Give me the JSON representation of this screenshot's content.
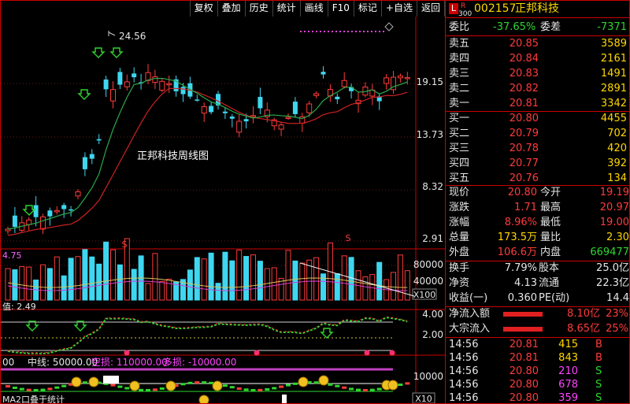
{
  "toolbar": {
    "items": [
      "复权",
      "叠加",
      "历史",
      "统计",
      "画线",
      "F10",
      "标记",
      "+自选",
      "返回"
    ]
  },
  "chart": {
    "title": "正邦科技周线图",
    "high_label": "24.56",
    "price_ticks": [
      "19.15",
      "13.73",
      "8.32",
      "2.91"
    ],
    "vol_left_label": "4.75",
    "vol_ticks": [
      "80000",
      "40000"
    ],
    "vol_unit": "X100",
    "ind_left_label": "值: 2.49",
    "ind_ticks": [
      "4.00",
      "2.00"
    ],
    "bottom_prefix": "00",
    "bottom_mid_label": "中线: 50000.00",
    "bottom_empty_label": "空损: 110000.00",
    "bottom_long_label": "多损: -10000.00",
    "bottom_tick": "10000",
    "bottom_unit": "X10",
    "bottom_caption": "MA2口叠于统计",
    "marker_s": "S",
    "colors": {
      "up": "#ff3b3b",
      "down": "#3fd7f0",
      "ma1": "#d8c060",
      "ma2": "#cc2222",
      "ma3": "#2aa84a"
    }
  },
  "quote": {
    "logo_l": "L",
    "logo_r": "R",
    "logo_code": "300",
    "code": "002157",
    "name": "正邦科技",
    "weibi_label": "委比",
    "weibi": "-37.65%",
    "weicha_label": "委差",
    "weicha": "-7371",
    "sells": [
      {
        "label": "卖五",
        "price": "20.85",
        "vol": "3589"
      },
      {
        "label": "卖四",
        "price": "20.84",
        "vol": "2161"
      },
      {
        "label": "卖三",
        "price": "20.83",
        "vol": "1491"
      },
      {
        "label": "卖二",
        "price": "20.82",
        "vol": "2891"
      },
      {
        "label": "卖一",
        "price": "20.81",
        "vol": "3342"
      }
    ],
    "buys": [
      {
        "label": "买一",
        "price": "20.80",
        "vol": "4455"
      },
      {
        "label": "买二",
        "price": "20.79",
        "vol": "702"
      },
      {
        "label": "买三",
        "price": "20.78",
        "vol": "420"
      },
      {
        "label": "买四",
        "price": "20.77",
        "vol": "392"
      },
      {
        "label": "买五",
        "price": "20.76",
        "vol": "134"
      }
    ],
    "stats": [
      {
        "l1": "现价",
        "v1": "20.80",
        "l2": "今开",
        "v2": "19.19"
      },
      {
        "l1": "涨跌",
        "v1": "1.71",
        "l2": "最高",
        "v2": "20.97"
      },
      {
        "l1": "涨幅",
        "v1": "8.96%",
        "l2": "最低",
        "v2": "19.00"
      },
      {
        "l1": "总量",
        "v1": "173.5万",
        "l2": "量比",
        "v2": "2.30"
      },
      {
        "l1": "外盘",
        "v1": "106.6万",
        "l2": "内盘",
        "v2": "669477"
      }
    ],
    "stats2": [
      {
        "l1": "换手",
        "v1": "7.79%",
        "l2": "股本",
        "v2": "25.0亿"
      },
      {
        "l1": "净资",
        "v1": "4.13",
        "l2": "流通",
        "v2": "22.3亿"
      },
      {
        "l1": "收益(一)",
        "v1": "0.360",
        "l2": "PE(动)",
        "v2": "14.4"
      }
    ],
    "flows": [
      {
        "label": "净流入额",
        "value": "8.10亿",
        "pct": "23%"
      },
      {
        "label": "大宗流入",
        "value": "8.65亿",
        "pct": "25%"
      }
    ],
    "ticks": [
      {
        "time": "14:56",
        "price": "20.81",
        "vol": "415",
        "side": "B"
      },
      {
        "time": "14:56",
        "price": "20.81",
        "vol": "843",
        "side": "B"
      },
      {
        "time": "14:56",
        "price": "20.80",
        "vol": "210",
        "side": "S"
      },
      {
        "time": "14:56",
        "price": "20.80",
        "vol": "678",
        "side": "S"
      },
      {
        "time": "14:56",
        "price": "20.80",
        "vol": "359",
        "side": "S"
      }
    ]
  }
}
